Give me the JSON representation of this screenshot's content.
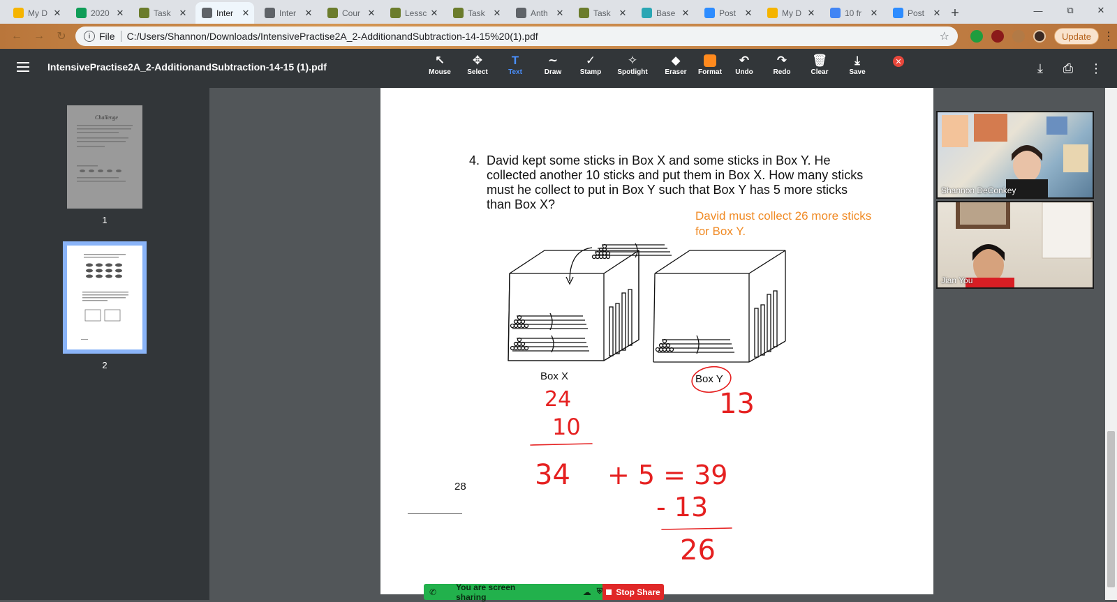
{
  "browser": {
    "tabs": [
      {
        "title": "My D",
        "icon": "drive-icon",
        "color": "#f5b400"
      },
      {
        "title": "2020",
        "icon": "sheets-icon",
        "color": "#0f9d58"
      },
      {
        "title": "Task",
        "icon": "task-icon",
        "color": "#6b7c2c"
      },
      {
        "title": "Inter",
        "icon": "globe-icon",
        "color": "#5f6368",
        "active": true
      },
      {
        "title": "Inter",
        "icon": "globe-icon",
        "color": "#5f6368"
      },
      {
        "title": "Cour",
        "icon": "task-icon",
        "color": "#6b7c2c"
      },
      {
        "title": "Lessc",
        "icon": "task-icon",
        "color": "#6b7c2c"
      },
      {
        "title": "Task",
        "icon": "task-icon",
        "color": "#6b7c2c"
      },
      {
        "title": "Anth",
        "icon": "globe-icon",
        "color": "#5f6368"
      },
      {
        "title": "Task",
        "icon": "task-icon",
        "color": "#6b7c2c"
      },
      {
        "title": "Base",
        "icon": "base-icon",
        "color": "#2aa6b4"
      },
      {
        "title": "Post",
        "icon": "zoom-icon",
        "color": "#2d8cff"
      },
      {
        "title": "My D",
        "icon": "drive-icon",
        "color": "#f5b400"
      },
      {
        "title": "10 fr",
        "icon": "docs-icon",
        "color": "#4285f4"
      },
      {
        "title": "Post",
        "icon": "zoom-icon",
        "color": "#2d8cff"
      }
    ],
    "address": {
      "scheme": "File",
      "url": "C:/Users/Shannon/Downloads/IntensivePractise2A_2-AdditionandSubtraction-14-15%20(1).pdf"
    },
    "update_label": "Update"
  },
  "pdf": {
    "title": "IntensivePractise2A_2-AdditionandSubtraction-14-15 (1).pdf",
    "tools": [
      {
        "label": "Mouse",
        "icon": "pointer-icon"
      },
      {
        "label": "Select",
        "icon": "move-icon"
      },
      {
        "label": "Text",
        "icon": "text-icon",
        "active": true
      },
      {
        "label": "Draw",
        "icon": "draw-icon"
      },
      {
        "label": "Stamp",
        "icon": "check-icon"
      },
      {
        "label": "Spotlight",
        "icon": "spotlight-icon"
      },
      {
        "label": "Eraser",
        "icon": "eraser-icon"
      },
      {
        "label": "Format",
        "icon": "format-icon",
        "color": "#ff8a1e"
      },
      {
        "label": "Undo",
        "icon": "undo-icon"
      },
      {
        "label": "Redo",
        "icon": "redo-icon"
      },
      {
        "label": "Clear",
        "icon": "trash-icon"
      },
      {
        "label": "Save",
        "icon": "save-icon"
      }
    ],
    "thumbnails": [
      {
        "number": "1"
      },
      {
        "number": "2"
      }
    ],
    "page": {
      "question_number": "4.",
      "question": "David kept some sticks in Box X and some sticks in Box Y. He collected another 10 sticks and put them in Box X. How many sticks must he collect to put in Box Y such that Box Y has 5 more sticks than Box X?",
      "answer": "David must collect 26 more sticks for Box Y.",
      "box_x_label": "Box X",
      "box_y_label": "Box Y",
      "page_number": "28",
      "handwriting": {
        "box_x_top": "24",
        "box_x_add": "10",
        "box_x_sum": "34",
        "plus_five": "+ 5 = 39",
        "minus": "- 13",
        "box_y_count": "13",
        "result": "26"
      }
    }
  },
  "video": {
    "participants": [
      {
        "name": "Shannon DeConkey"
      },
      {
        "name": "Jian You"
      }
    ]
  },
  "screenshare": {
    "status": "You are screen sharing",
    "stop_label": "Stop Share"
  }
}
